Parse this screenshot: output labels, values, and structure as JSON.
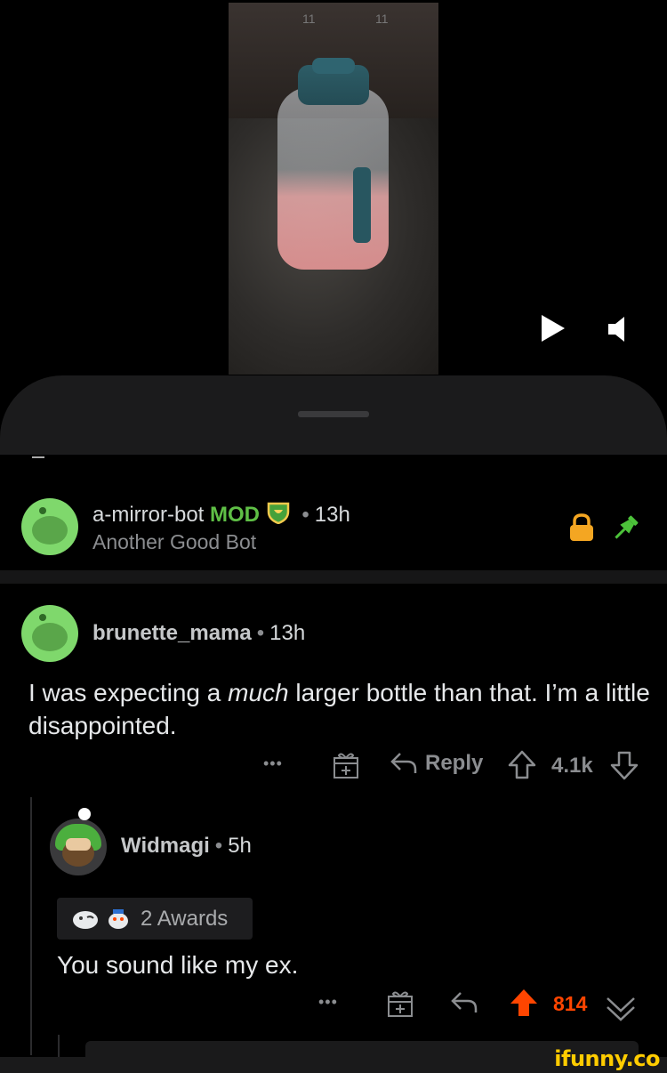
{
  "video": {
    "marks": [
      "11",
      "11"
    ]
  },
  "mod_comment": {
    "username": "a-mirror-bot",
    "mod_label": "MOD",
    "time": "13h",
    "text": "Another Good Bot"
  },
  "comment1": {
    "username": "brunette_mama",
    "time": "13h",
    "text_pre": "I was expecting a ",
    "text_em": "much",
    "text_post": " larger bottle than that. I’m a little disappointed.",
    "more": "•••",
    "reply_label": "Reply",
    "score": "4.1k"
  },
  "comment2": {
    "username": "Widmagi",
    "time": "5h",
    "awards_label": "2 Awards",
    "text": "You sound like my ex.",
    "more": "•••",
    "score": "814"
  },
  "watermark": "ifunny.co",
  "colors": {
    "accent_upvote": "#ff4500",
    "mod_green": "#5fbf46",
    "avatar_green": "#7fd86c"
  }
}
